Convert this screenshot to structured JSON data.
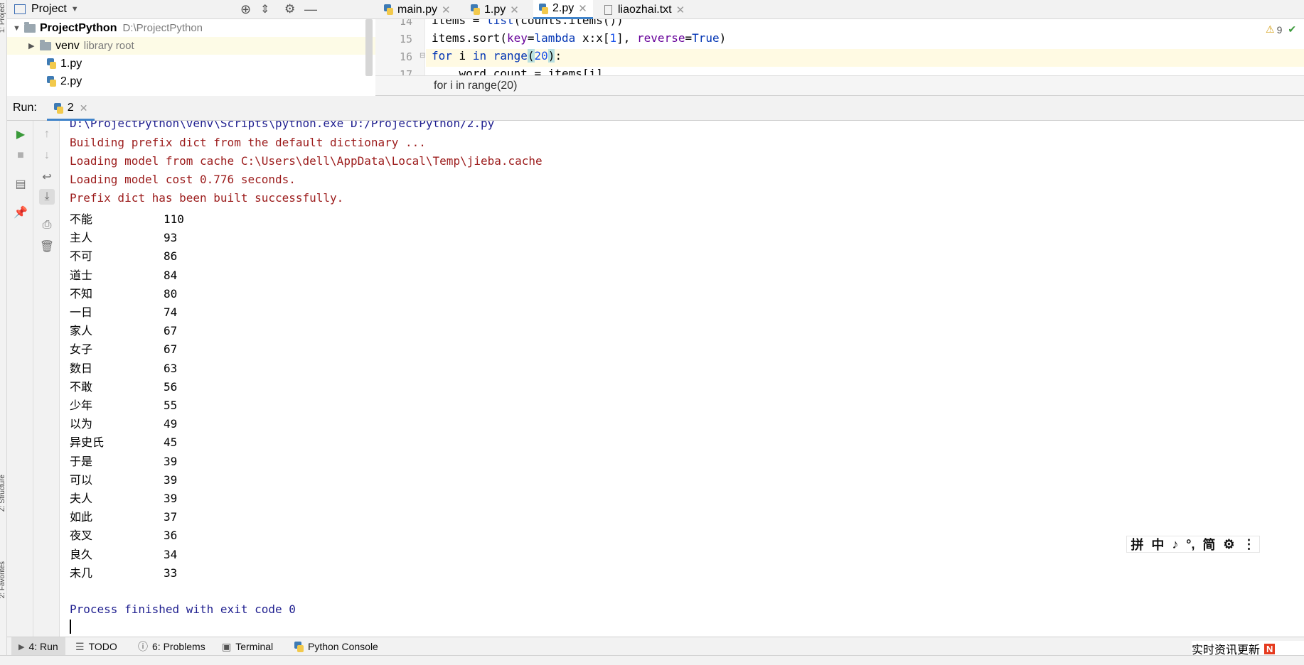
{
  "side_strip": {
    "project": "1: Project",
    "structure": "Z: Structure",
    "favorites": "2: Favorites"
  },
  "project_panel": {
    "title": "Project",
    "root": {
      "name": "ProjectPython",
      "path": "D:\\ProjectPython"
    },
    "items": [
      {
        "name": "venv",
        "note": "library root"
      },
      {
        "name": "1.py"
      },
      {
        "name": "2.py"
      }
    ]
  },
  "editor": {
    "tabs": [
      {
        "label": "main.py"
      },
      {
        "label": "1.py"
      },
      {
        "label": "2.py",
        "active": true
      },
      {
        "label": "liaozhai.txt"
      }
    ],
    "line_numbers": [
      "14",
      "15",
      "16",
      "17"
    ],
    "inspection_count": "9",
    "breadcrumb": "for i in range(20)"
  },
  "run": {
    "label": "Run:",
    "tab": "2",
    "command": "D:\\ProjectPython\\venv\\Scripts\\python.exe D:/ProjectPython/2.py",
    "log_lines": [
      "Building prefix dict from the default dictionary ...",
      "Loading model from cache C:\\Users\\dell\\AppData\\Local\\Temp\\jieba.cache",
      "Loading model cost 0.776 seconds.",
      "Prefix dict has been built successfully."
    ],
    "word_counts": [
      {
        "word": "不能",
        "count": "110"
      },
      {
        "word": "主人",
        "count": "93"
      },
      {
        "word": "不可",
        "count": "86"
      },
      {
        "word": "道士",
        "count": "84"
      },
      {
        "word": "不知",
        "count": "80"
      },
      {
        "word": "一日",
        "count": "74"
      },
      {
        "word": "家人",
        "count": "67"
      },
      {
        "word": "女子",
        "count": "67"
      },
      {
        "word": "数日",
        "count": "63"
      },
      {
        "word": "不敢",
        "count": "56"
      },
      {
        "word": "少年",
        "count": "55"
      },
      {
        "word": "以为",
        "count": "49"
      },
      {
        "word": "异史氏",
        "count": "45"
      },
      {
        "word": "于是",
        "count": "39"
      },
      {
        "word": "可以",
        "count": "39"
      },
      {
        "word": "夫人",
        "count": "39"
      },
      {
        "word": "如此",
        "count": "37"
      },
      {
        "word": "夜叉",
        "count": "36"
      },
      {
        "word": "良久",
        "count": "34"
      },
      {
        "word": "未几",
        "count": "33"
      }
    ],
    "exit_message": "Process finished with exit code 0"
  },
  "ime": {
    "items": [
      "拼",
      "中",
      "♪",
      "°,",
      "简",
      "⚙",
      "⋮"
    ]
  },
  "bottom_tabs": [
    {
      "label": "4: Run"
    },
    {
      "label": "TODO"
    },
    {
      "label": "6: Problems"
    },
    {
      "label": "Terminal"
    },
    {
      "label": "Python Console"
    }
  ],
  "notification": {
    "text": "实时资讯更新"
  }
}
